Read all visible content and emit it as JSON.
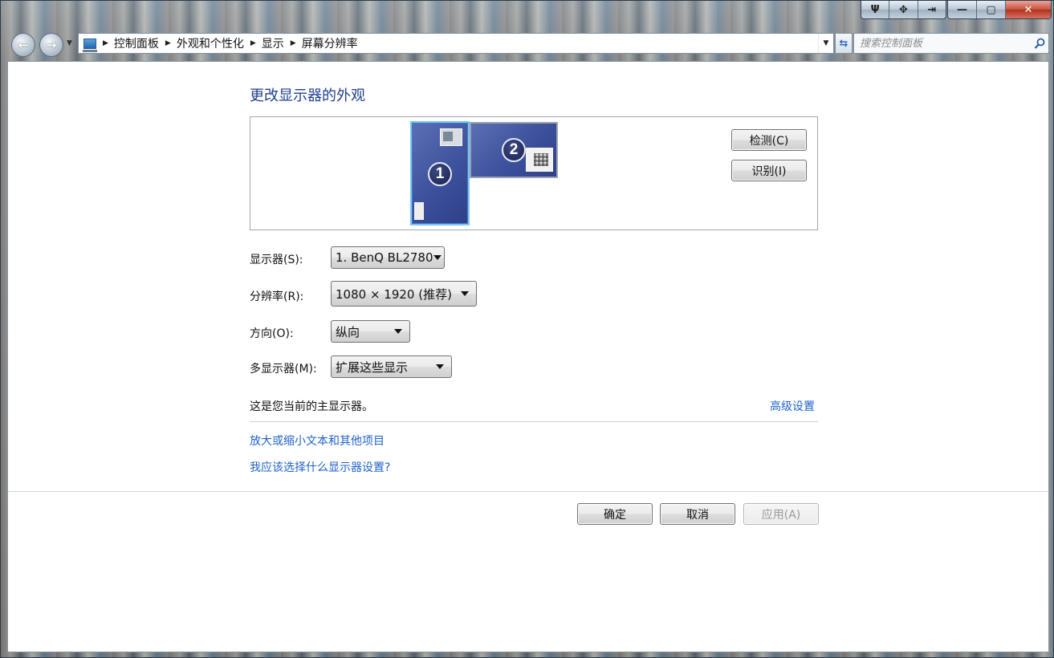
{
  "window": {
    "caption_buttons": [
      "pin-icon",
      "move-icon",
      "snap-icon"
    ],
    "minimize_glyph": "—",
    "maximize_glyph": "▢",
    "close_glyph": "✕"
  },
  "navbar": {
    "breadcrumbs": [
      "控制面板",
      "外观和个性化",
      "显示",
      "屏幕分辨率"
    ],
    "search_placeholder": "搜索控制面板"
  },
  "page": {
    "title": "更改显示器的外观",
    "monitors": [
      {
        "number": "1",
        "selected": true
      },
      {
        "number": "2",
        "selected": false
      }
    ],
    "detect_button": "检测(C)",
    "identify_button": "识别(I)",
    "fields": {
      "display_label": "显示器(S):",
      "display_value": "1. BenQ BL2780",
      "resolution_label": "分辨率(R):",
      "resolution_value": "1080 × 1920 (推荐)",
      "orientation_label": "方向(O):",
      "orientation_value": "纵向",
      "multi_label": "多显示器(M):",
      "multi_value": "扩展这些显示"
    },
    "primary_notice": "这是您当前的主显示器。",
    "advanced_link": "高级设置",
    "text_size_link": "放大或缩小文本和其他项目",
    "help_link": "我应该选择什么显示器设置?",
    "ok_button": "确定",
    "cancel_button": "取消",
    "apply_button": "应用(A)",
    "colors": {
      "link": "#1f63c9",
      "title": "#1e3f8c",
      "monitor": "#3b4f9a",
      "selection": "#7cc4f3"
    }
  }
}
